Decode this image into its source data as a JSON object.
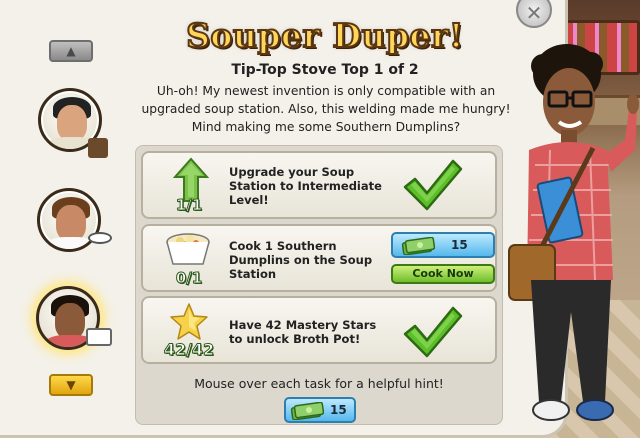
{
  "dialog": {
    "title": "Souper Duper!",
    "subtitle": "Tip-Top Stove Top 1 of 2",
    "description": "Uh-oh! My newest invention is only compatible with an upgraded soup station. Also, this welding made me hungry! Mind making me some Southern Dumplins?",
    "close_icon": "close-icon"
  },
  "tasks": [
    {
      "text": "Upgrade your Soup Station to Intermediate Level!",
      "progress": "1/1",
      "icon": "upgrade-arrow-icon",
      "complete": true
    },
    {
      "text": "Cook 1 Southern Dumplins on the Soup Station",
      "progress": "0/1",
      "icon": "dumplins-bowl-icon",
      "complete": false,
      "cost": "15",
      "cook_button": "Cook Now"
    },
    {
      "text": "Have 42 Mastery Stars to unlock Broth Pot!",
      "progress": "42/42",
      "icon": "mastery-star-icon",
      "complete": true
    }
  ],
  "hint": "Mouse over each task for a helpful hint!",
  "skip_cost": "15",
  "colors": {
    "title_fill": "#ffd65a",
    "title_outline": "#5a3612",
    "checkmark": "#5cbf2a",
    "cash_button": "#55b8ec",
    "cook_button": "#6fbd2c"
  }
}
